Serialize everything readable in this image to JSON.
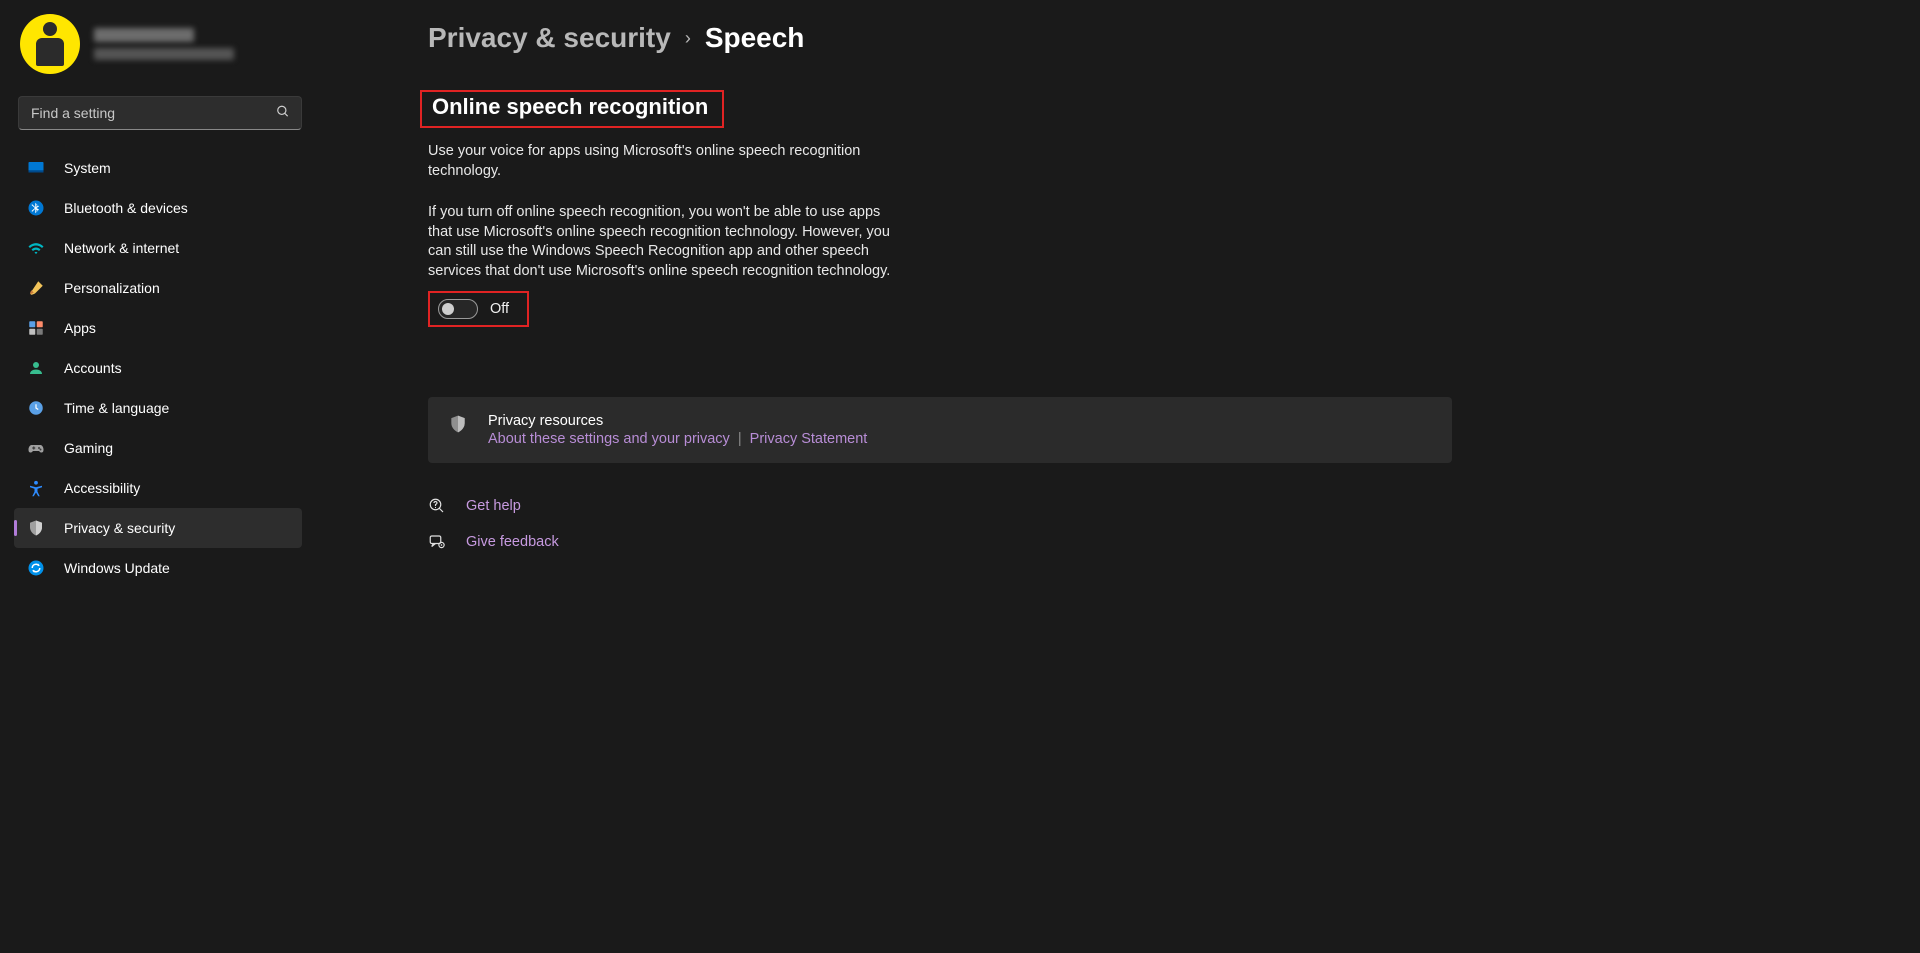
{
  "search": {
    "placeholder": "Find a setting"
  },
  "sidebar": {
    "items": [
      {
        "label": "System"
      },
      {
        "label": "Bluetooth & devices"
      },
      {
        "label": "Network & internet"
      },
      {
        "label": "Personalization"
      },
      {
        "label": "Apps"
      },
      {
        "label": "Accounts"
      },
      {
        "label": "Time & language"
      },
      {
        "label": "Gaming"
      },
      {
        "label": "Accessibility"
      },
      {
        "label": "Privacy & security"
      },
      {
        "label": "Windows Update"
      }
    ]
  },
  "breadcrumb": {
    "parent": "Privacy & security",
    "current": "Speech"
  },
  "section": {
    "title": "Online speech recognition",
    "desc1": "Use your voice for apps using Microsoft's online speech recognition technology.",
    "desc2": "If you turn off online speech recognition, you won't be able to use apps that use Microsoft's online speech recognition technology.  However, you can still use the Windows Speech Recognition app and other speech services that don't use Microsoft's online speech recognition technology.",
    "toggle_state": "Off"
  },
  "resources": {
    "title": "Privacy resources",
    "link1": "About these settings and your privacy",
    "link2": "Privacy Statement"
  },
  "footer": {
    "get_help": "Get help",
    "give_feedback": "Give feedback"
  }
}
